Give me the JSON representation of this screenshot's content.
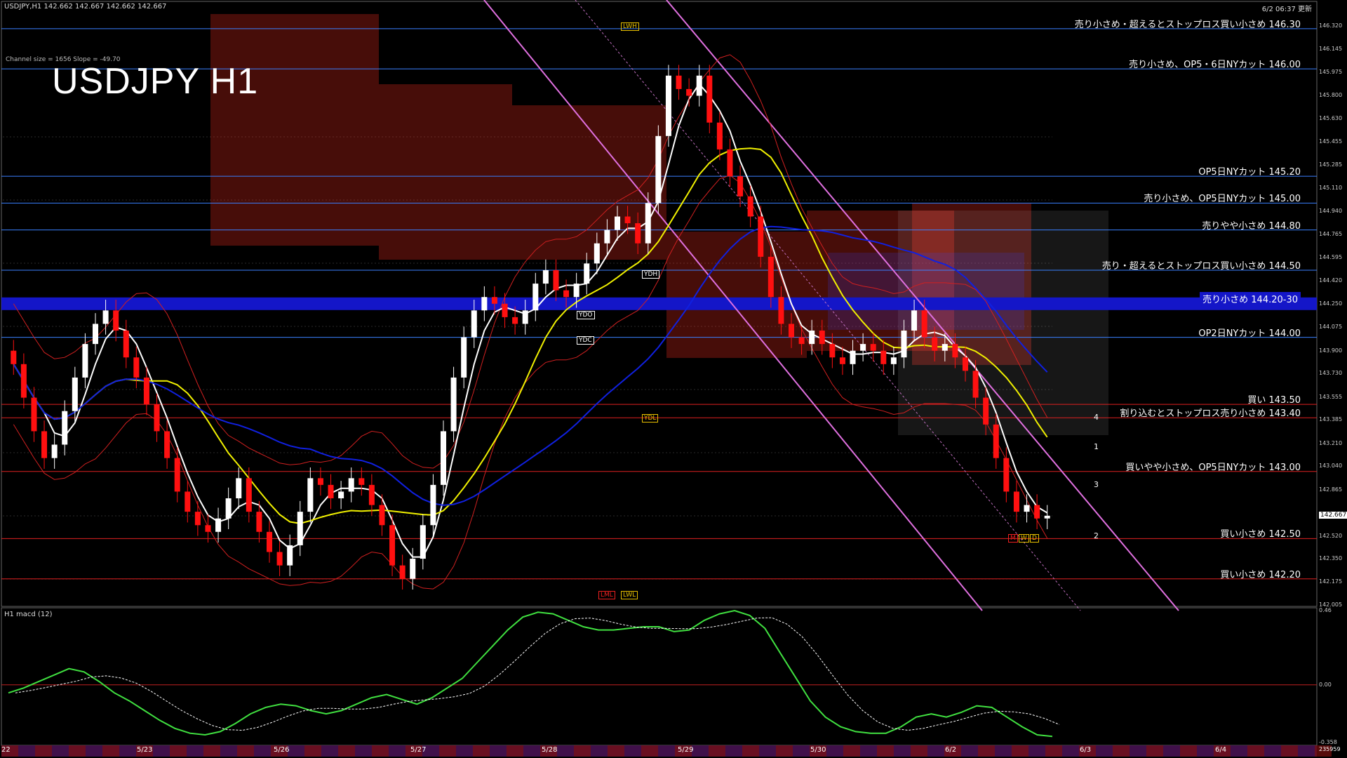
{
  "header": {
    "symbol_info": "USDJPY,H1 142.662 142.667 142.662 142.667",
    "updated": "6/2 06:37 更新",
    "channel_info": "Channel size = 1656  Slope = -49.70",
    "chart_title": "USDJPY H1",
    "macd_label": "H1 macd (12)"
  },
  "annotations": [
    {
      "text": "売り小さめ・超えるとストップロス買い小さめ 146.30",
      "price": 146.3
    },
    {
      "text": "売り小さめ、OP5・6日NYカット 146.00",
      "price": 146.0
    },
    {
      "text": "OP5日NYカット 145.20",
      "price": 145.2
    },
    {
      "text": "売り小さめ、OP5日NYカット 145.00",
      "price": 145.0
    },
    {
      "text": "売りやや小さめ 144.80",
      "price": 144.8
    },
    {
      "text": "売り・超えるとストップロス買い小さめ 144.50",
      "price": 144.5
    },
    {
      "text": "売り小さめ 144.20-30",
      "price": 144.25
    },
    {
      "text": "OP2日NYカット 144.00",
      "price": 144.0
    },
    {
      "text": "買い 143.50",
      "price": 143.5
    },
    {
      "text": "割り込むとストップロス売り小さめ 143.40",
      "price": 143.4
    },
    {
      "text": "買いやや小さめ、OP5日NYカット 143.00",
      "price": 143.0
    },
    {
      "text": "買い小さめ 142.50",
      "price": 142.5
    },
    {
      "text": "買い小さめ 142.20",
      "price": 142.2
    }
  ],
  "price_axis": [
    "146.320",
    "146.145",
    "145.975",
    "145.800",
    "145.630",
    "145.455",
    "145.285",
    "145.110",
    "144.940",
    "144.765",
    "144.595",
    "144.420",
    "144.250",
    "144.075",
    "143.900",
    "143.730",
    "143.555",
    "143.385",
    "143.210",
    "143.040",
    "142.865",
    "142.520",
    "142.350",
    "142.175",
    "142.005"
  ],
  "current_price": "142.667",
  "macd_axis": [
    "0.46",
    "0.00",
    "-0.358"
  ],
  "dates": [
    {
      "label": "5/23",
      "x": 195
    },
    {
      "label": "5/26",
      "x": 390
    },
    {
      "label": "5/27",
      "x": 585
    },
    {
      "label": "5/28",
      "x": 772
    },
    {
      "label": "5/29",
      "x": 966
    },
    {
      "label": "5/30",
      "x": 1155
    },
    {
      "label": "6/2",
      "x": 1347
    },
    {
      "label": "6/3",
      "x": 1539
    },
    {
      "label": "6/4",
      "x": 1732
    }
  ],
  "axis_edge_labels": {
    "left": "22",
    "right": "235959"
  },
  "wave_labels": [
    {
      "text": "4",
      "price": 143.4
    },
    {
      "text": "1",
      "price": 143.18
    },
    {
      "text": "3",
      "price": 142.9
    },
    {
      "text": "2",
      "price": 142.52
    }
  ],
  "level_tags": [
    "LWH",
    "YDH",
    "YDO",
    "YDC",
    "YDL",
    "LWL",
    "LML",
    "M",
    "W",
    "D"
  ],
  "colors": {
    "bull": "#ffffff",
    "bear": "#ff1010",
    "ma_blue": "#1020e0",
    "ma_yellow": "#f0f000",
    "ma_white": "#ffffff",
    "macd": "#40e040",
    "macd_neg": "#e07090",
    "signal": "#ffffff",
    "channel": "#e070e0",
    "cloud": "#ff3020",
    "band": "#1416c8"
  },
  "chart_data": {
    "type": "candlestick",
    "title": "USDJPY H1",
    "ylim": [
      142.005,
      146.32
    ],
    "close": [
      143.8,
      143.55,
      143.3,
      143.1,
      143.2,
      143.45,
      143.7,
      143.95,
      144.1,
      144.2,
      144.05,
      143.85,
      143.7,
      143.5,
      143.3,
      143.1,
      142.85,
      142.7,
      142.6,
      142.55,
      142.65,
      142.8,
      142.95,
      142.7,
      142.55,
      142.4,
      142.3,
      142.45,
      142.7,
      142.95,
      142.9,
      142.8,
      142.85,
      142.95,
      142.9,
      142.75,
      142.6,
      142.3,
      142.2,
      142.35,
      142.6,
      142.9,
      143.3,
      143.7,
      144.0,
      144.2,
      144.3,
      144.25,
      144.15,
      144.1,
      144.2,
      144.4,
      144.5,
      144.35,
      144.3,
      144.4,
      144.55,
      144.7,
      144.8,
      144.9,
      144.85,
      144.7,
      145.0,
      145.5,
      145.95,
      145.85,
      145.8,
      145.95,
      145.6,
      145.4,
      145.2,
      145.05,
      144.9,
      144.6,
      144.3,
      144.1,
      144.0,
      143.95,
      144.05,
      143.95,
      143.85,
      143.8,
      143.9,
      143.95,
      143.9,
      143.8,
      143.85,
      144.05,
      144.2,
      144.0,
      143.9,
      143.95,
      143.85,
      143.75,
      143.55,
      143.35,
      143.1,
      142.85,
      142.7,
      142.75,
      142.65,
      142.67
    ],
    "macd": [
      -0.05,
      -0.02,
      0.02,
      0.06,
      0.1,
      0.08,
      0.02,
      -0.05,
      -0.1,
      -0.16,
      -0.22,
      -0.27,
      -0.3,
      -0.31,
      -0.29,
      -0.24,
      -0.18,
      -0.14,
      -0.12,
      -0.13,
      -0.16,
      -0.18,
      -0.16,
      -0.12,
      -0.08,
      -0.06,
      -0.09,
      -0.12,
      -0.08,
      -0.02,
      0.04,
      0.14,
      0.24,
      0.34,
      0.42,
      0.45,
      0.44,
      0.4,
      0.36,
      0.34,
      0.34,
      0.35,
      0.36,
      0.36,
      0.33,
      0.34,
      0.4,
      0.44,
      0.46,
      0.43,
      0.35,
      0.2,
      0.05,
      -0.1,
      -0.2,
      -0.26,
      -0.29,
      -0.3,
      -0.3,
      -0.26,
      -0.2,
      -0.18,
      -0.2,
      -0.17,
      -0.13,
      -0.14,
      -0.2,
      -0.26,
      -0.31,
      -0.32
    ],
    "moving_averages": [
      "white",
      "yellow",
      "blue"
    ],
    "indicators": [
      "ichimoku cloud",
      "bollinger bands",
      "trend channel",
      "macd"
    ]
  }
}
